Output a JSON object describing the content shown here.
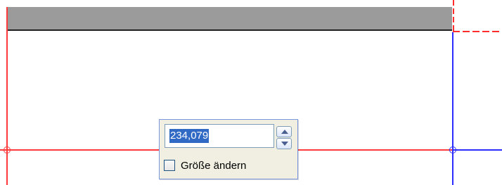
{
  "popup": {
    "size_value": "234,079",
    "checkbox_label": "Größe ändern",
    "checkbox_checked": false
  },
  "colors": {
    "gray_bar": "#9b9b9b",
    "red_line": "#ff3b3b",
    "blue_line": "#2c2cff",
    "dashed_red": "#ff2d2d",
    "popup_bg": "#f1efe2",
    "selection": "#316ac5"
  },
  "icons": {
    "spin_up": "chevron-up-icon",
    "spin_down": "chevron-down-icon",
    "left_handle": "circle-handle-icon",
    "right_handle": "circle-handle-icon"
  }
}
